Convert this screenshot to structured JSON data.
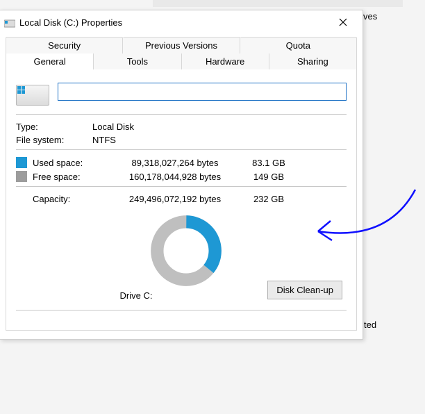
{
  "background": {
    "fragment1": "ves",
    "fragment2": "ted"
  },
  "window": {
    "title": "Local Disk (C:) Properties",
    "tabs_row1": [
      "Security",
      "Previous Versions",
      "Quota"
    ],
    "tabs_row2": [
      "General",
      "Tools",
      "Hardware",
      "Sharing"
    ],
    "active_tab": "General"
  },
  "drive": {
    "name_value": "",
    "type_label": "Type:",
    "type_value": "Local Disk",
    "fs_label": "File system:",
    "fs_value": "NTFS"
  },
  "space": {
    "used_label": "Used space:",
    "used_bytes": "89,318,027,264 bytes",
    "used_gb": "83.1 GB",
    "free_label": "Free space:",
    "free_bytes": "160,178,044,928 bytes",
    "free_gb": "149 GB",
    "capacity_label": "Capacity:",
    "capacity_bytes": "249,496,072,192 bytes",
    "capacity_gb": "232 GB"
  },
  "chart_data": {
    "type": "pie",
    "title": "Drive C:",
    "series": [
      {
        "name": "Used space",
        "value": 89318027264,
        "color": "#1e98d4"
      },
      {
        "name": "Free space",
        "value": 160178044928,
        "color": "#9c9c9c"
      }
    ]
  },
  "footer": {
    "drive_letter": "Drive C:",
    "cleanup_label": "Disk Clean-up"
  }
}
